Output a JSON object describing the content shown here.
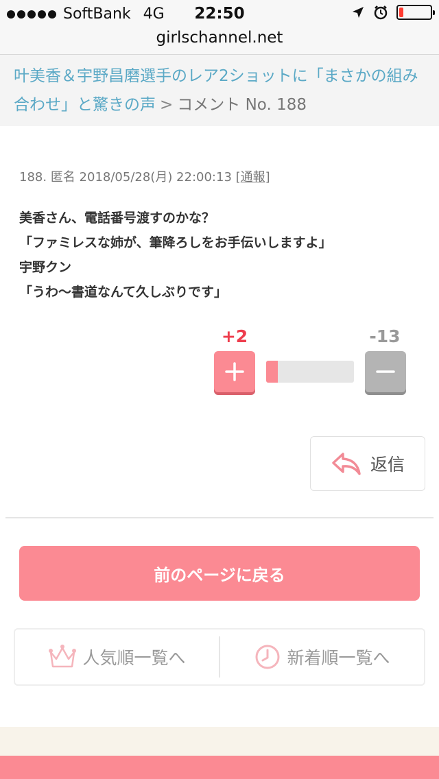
{
  "status_bar": {
    "carrier": "SoftBank",
    "network": "4G",
    "time": "22:50"
  },
  "url_bar": {
    "domain": "girlschannel.net"
  },
  "breadcrumb": {
    "topic_link": "叶美香＆宇野昌磨選手のレア2ショットに「まさかの組み合わせ」と驚きの声",
    "separator": ">",
    "current": "コメント No. 188"
  },
  "comment": {
    "number": "188.",
    "author": "匿名",
    "datetime": "2018/05/28(月) 22:00:13",
    "report_open": "[",
    "report_label": "通報",
    "report_close": "]",
    "lines": [
      "美香さん、電話番号渡すのかな？",
      "「ファミレスな姉が、筆降ろしをお手伝いしますよ」",
      "宇野クン",
      "「うわ〜書道なんて久しぶりです」"
    ]
  },
  "votes": {
    "plus_count": "+2",
    "minus_count": "-13",
    "plus_ratio": 0.133
  },
  "reply_label": "返信",
  "back_button_label": "前のページに戻る",
  "list_nav": {
    "popular_label": "人気順一覧へ",
    "newest_label": "新着順一覧へ"
  },
  "colors": {
    "accent_pink": "#fb8a93",
    "plus_red": "#ee3d4d",
    "link_blue": "#5ba9c6"
  }
}
